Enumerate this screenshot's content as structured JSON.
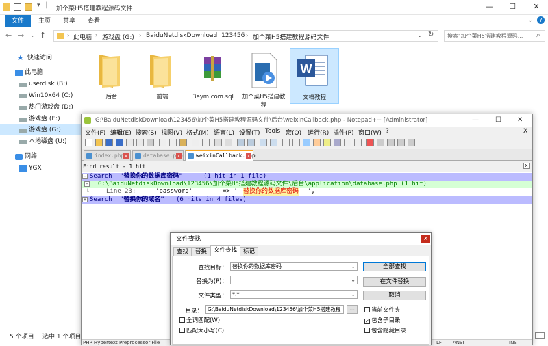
{
  "explorer": {
    "title": "加个菜H5搭建教程源码文件",
    "window_controls": [
      "—",
      "☐",
      "✕"
    ],
    "ribbon_tabs": [
      "文件",
      "主页",
      "共享",
      "查看"
    ],
    "breadcrumb": [
      "此电脑",
      "游戏盘 (G:)",
      "BaiduNetdiskDownload",
      "123456",
      "加个菜H5搭建教程源码文件"
    ],
    "search_placeholder": "搜索\"加个菜H5搭建教程源码...",
    "nav": [
      {
        "label": "快速访问",
        "icon": "star-icon"
      },
      {
        "label": "此电脑",
        "icon": "pc-icon"
      },
      {
        "label": "userdisk (B:)",
        "icon": "drive-icon"
      },
      {
        "label": "Win10x64 (C:)",
        "icon": "drive-icon"
      },
      {
        "label": "热门游戏盘 (D:)",
        "icon": "drive-icon"
      },
      {
        "label": "游戏盘 (E:)",
        "icon": "drive-icon"
      },
      {
        "label": "游戏盘 (G:)",
        "icon": "drive-icon"
      },
      {
        "label": "本地磁盘 (U:)",
        "icon": "drive-icon"
      },
      {
        "label": "网络",
        "icon": "network-icon"
      },
      {
        "label": "YGX",
        "icon": "pc-icon"
      }
    ],
    "files": [
      {
        "name": "后台",
        "type": "folder"
      },
      {
        "name": "前端",
        "type": "folder"
      },
      {
        "name": "3eym.com.sql",
        "type": "archive"
      },
      {
        "name": "加个菜H5搭建教程",
        "type": "video"
      },
      {
        "name": "文档教程",
        "type": "word"
      }
    ],
    "status": [
      "5 个项目",
      "选中 1 个项目"
    ]
  },
  "npp": {
    "title": "G:\\BaiduNetdiskDownload\\123456\\加个菜H5搭建教程源码文件\\后台\\weixinCallback.php - Notepad++ [Administrator]",
    "menu": [
      "文件(F)",
      "编辑(E)",
      "搜索(S)",
      "视图(V)",
      "格式(M)",
      "语言(L)",
      "设置(T)",
      "Tools",
      "宏(O)",
      "运行(R)",
      "插件(P)",
      "窗口(W)",
      "?"
    ],
    "close_x": "X",
    "tabs": [
      "index.php",
      "database.php",
      "weixinCallback.php"
    ],
    "find_head": "Find result - 1 hit",
    "result_lines": [
      {
        "prefix": "Search ",
        "term": "\"替换你的数据库密码\"",
        "suffix": " (1 hit in 1 file)"
      },
      {
        "path": "G:\\BaiduNetdiskDownload\\123456\\加个菜H5搭建教程源码文件\\后台\\application\\database.php (1 hit)"
      },
      {
        "line_no": "Line 23:",
        "key": "'password'",
        "arrow": "=> '",
        "value": "替换你的数据库密码",
        "tail": "',"
      },
      {
        "prefix": "Search ",
        "term": "\"替换你的域名\"",
        "suffix": " (6 hits in 4 files)"
      }
    ],
    "status_left": "PHP Hypertext Preprocessor File",
    "status_right": [
      "LF",
      "ANSI",
      "INS"
    ]
  },
  "dialog": {
    "title": "文件查找",
    "tabs": [
      "查找",
      "替换",
      "文件查找",
      "标记"
    ],
    "find_label": "查找目标：",
    "find_value": "替换你的数据库密码",
    "replace_label": "替换为(P)：",
    "replace_value": "",
    "filter_label": "文件类型：",
    "filter_value": "*.*",
    "dir_label": "目录：",
    "dir_value": "G:\\BaiduNetdiskDownload\\123456\\加个菜H5搭建教程",
    "dir_browse": "...",
    "btn_find_all": "全部查找",
    "btn_replace": "在文件替换",
    "btn_cancel": "取消",
    "chk_current": "当前文件夹",
    "chk_sub": "包含子目录",
    "chk_hidden": "包含隐藏目录",
    "chk_whole": "全词匹配(W)",
    "chk_case": "匹配大小写(C)"
  }
}
